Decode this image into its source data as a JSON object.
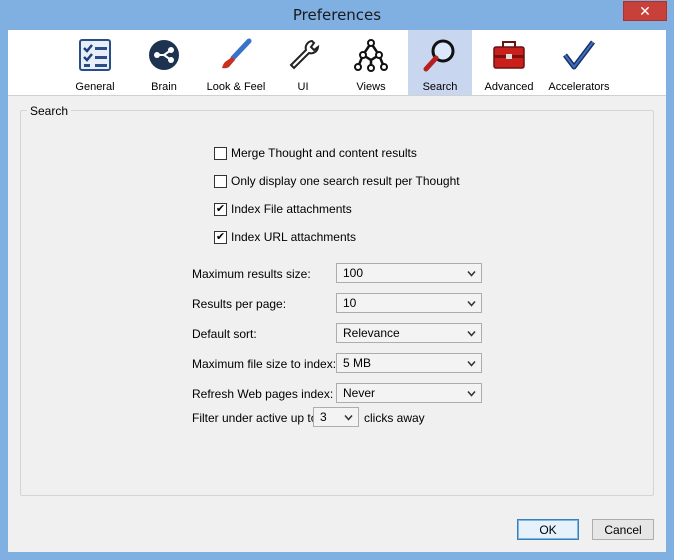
{
  "window": {
    "title": "Preferences",
    "close_glyph": "✕"
  },
  "tabs": [
    {
      "label": "General",
      "icon": "checklist-icon"
    },
    {
      "label": "Brain",
      "icon": "brain-icon"
    },
    {
      "label": "Look & Feel",
      "icon": "paintbrush-icon"
    },
    {
      "label": "UI",
      "icon": "wrench-icon"
    },
    {
      "label": "Views",
      "icon": "views-icon"
    },
    {
      "label": "Search",
      "icon": "magnifier-icon",
      "active": true
    },
    {
      "label": "Advanced",
      "icon": "toolbox-icon"
    },
    {
      "label": "Accelerators",
      "icon": "checkmark-icon"
    }
  ],
  "search": {
    "group_title": "Search",
    "checkboxes": [
      {
        "label": "Merge Thought and content results",
        "checked": false
      },
      {
        "label": "Only display one search result per Thought",
        "checked": false
      },
      {
        "label": "Index File attachments",
        "checked": true
      },
      {
        "label": "Index URL attachments",
        "checked": true
      }
    ],
    "fields": [
      {
        "label": "Maximum results size:",
        "value": "100"
      },
      {
        "label": "Results per page:",
        "value": "10"
      },
      {
        "label": "Default sort:",
        "value": "Relevance"
      },
      {
        "label": "Maximum file size to index:",
        "value": "5 MB"
      },
      {
        "label": "Refresh Web pages index:",
        "value": "Never"
      }
    ],
    "filter": {
      "prefix": "Filter under active up to",
      "value": "3",
      "suffix": "clicks away"
    }
  },
  "buttons": {
    "ok": "OK",
    "cancel": "Cancel"
  },
  "colors": {
    "active_tab": "#c9d6ef",
    "frame": "#80b0e2",
    "close": "#c7403a"
  }
}
